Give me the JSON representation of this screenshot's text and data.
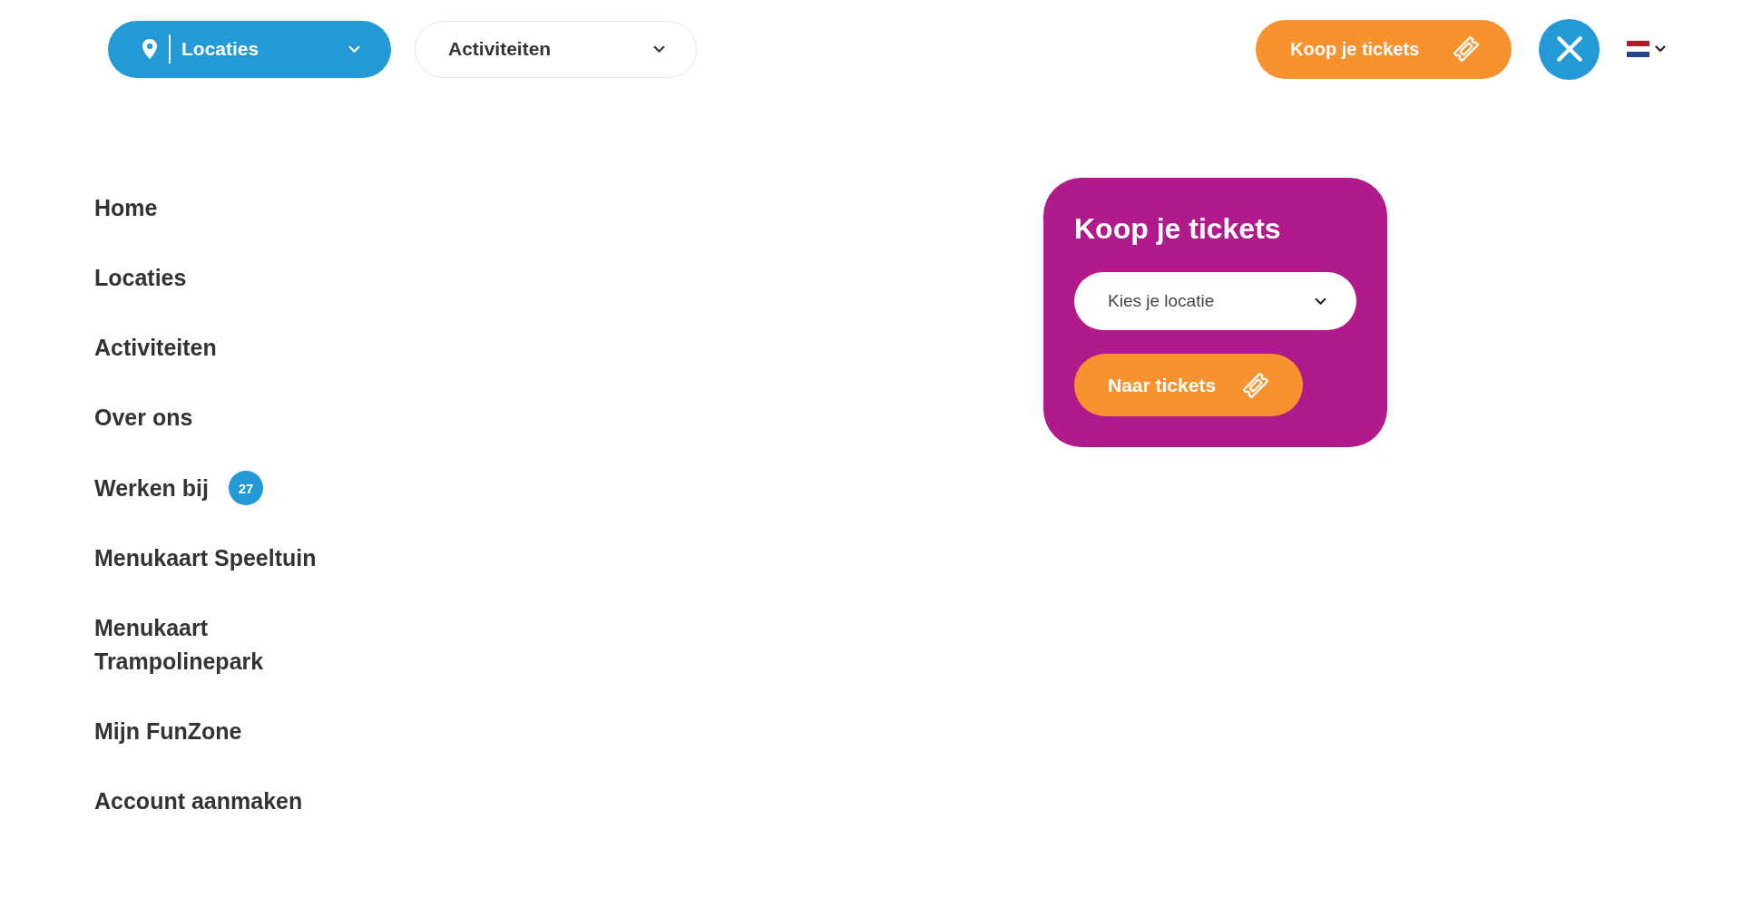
{
  "header": {
    "dropdowns": [
      {
        "kind": "location",
        "label": "Locaties"
      },
      {
        "kind": "activity",
        "label": "Activiteiten"
      }
    ],
    "ticket_button": {
      "label": "Koop je tickets"
    }
  },
  "menu": {
    "items": [
      {
        "label": "Home"
      },
      {
        "label": "Locaties"
      },
      {
        "label": "Activiteiten"
      },
      {
        "label": "Over ons"
      },
      {
        "label": "Werken bij",
        "badge": "27"
      },
      {
        "label": "Menukaart Speeltuin"
      },
      {
        "label": "Menukaart Trampolinepark"
      },
      {
        "label": "Mijn FunZone"
      },
      {
        "label": "Account aanmaken"
      }
    ]
  },
  "ticket_card": {
    "title": "Koop je tickets",
    "location_select": {
      "placeholder": "Kies je locatie"
    },
    "button": {
      "label": "Naar tickets"
    }
  }
}
